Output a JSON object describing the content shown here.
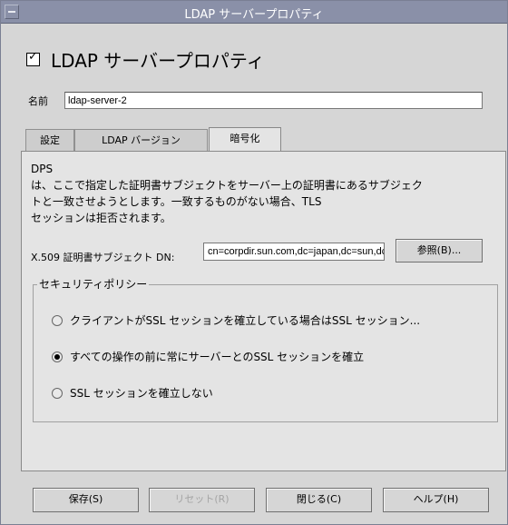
{
  "window": {
    "title": "LDAP サーバープロパティ"
  },
  "header": {
    "enabled": true,
    "title": "LDAP サーバープロパティ"
  },
  "name_field": {
    "label": "名前",
    "value": "ldap-server-2"
  },
  "tabs": [
    {
      "label": "設定",
      "active": false
    },
    {
      "label": "LDAP バージョン",
      "active": false
    },
    {
      "label": "暗号化",
      "active": true
    }
  ],
  "encryption": {
    "description": "DPS\nは、ここで指定した証明書サブジェクトをサーバー上の証明書にあるサブジェク\nトと一致させようとします。一致するものがない場合、TLS\nセッションは拒否されます。",
    "cert_label": "X.509 証明書サブジェクト DN:",
    "cert_value": "cn=corpdir.sun.com,dc=japan,dc=sun,dc=com",
    "browse_button": "参照(B)..."
  },
  "security_policy": {
    "title": "セキュリティポリシー",
    "options": [
      {
        "label": "クライアントがSSL セッションを確立している場合はSSL セッション...",
        "selected": false
      },
      {
        "label": "すべての操作の前に常にサーバーとのSSL セッションを確立",
        "selected": true
      },
      {
        "label": "SSL セッションを確立しない",
        "selected": false
      }
    ]
  },
  "footer": {
    "save": "保存(S)",
    "reset": "リセット(R)",
    "close": "閉じる(C)",
    "help": "ヘルプ(H)"
  }
}
